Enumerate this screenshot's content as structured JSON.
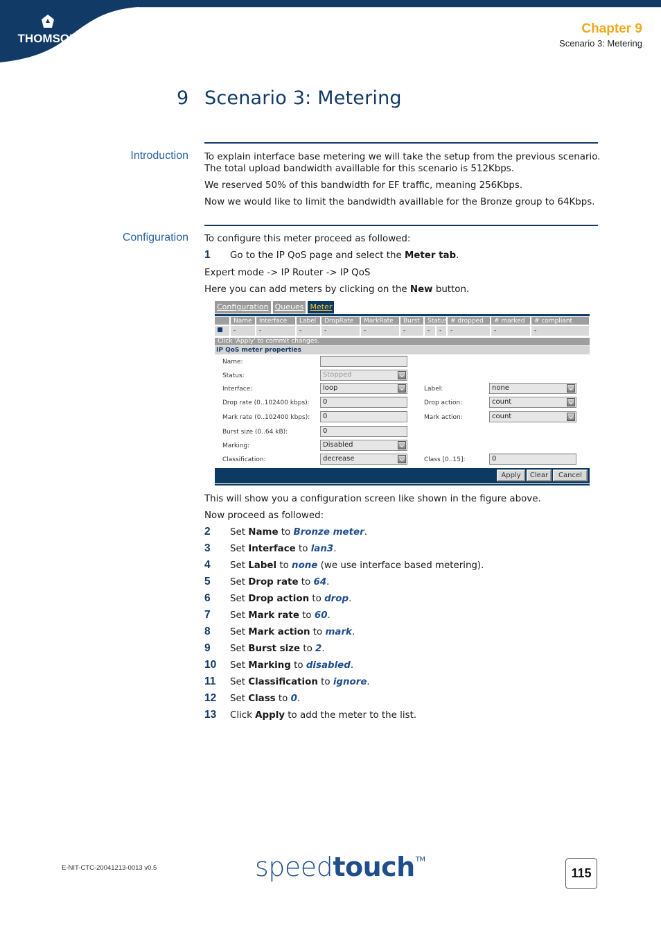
{
  "header": {
    "brand_logo": "THOMSON",
    "chapter": "Chapter 9",
    "chapter_subtitle": "Scenario 3: Metering",
    "colors": {
      "navy": "#123a66",
      "chapter_orange": "#f3a81b"
    }
  },
  "title": {
    "number": "9",
    "text": "Scenario 3: Metering"
  },
  "introduction": {
    "heading": "Introduction",
    "paragraphs": [
      "To explain interface base metering we will take the setup from the previous scenario.",
      "The total upload bandwidth availlable for this scenario is 512Kbps.",
      "We reserved 50% of this bandwidth for EF traffic, meaning 256Kbps.",
      "Now we would like to limit the bandwidth availlable for the Bronze group to 64Kbps."
    ]
  },
  "configuration": {
    "heading": "Configuration",
    "lead": "To configure this meter proceed as followed:",
    "step1": {
      "num": "1",
      "pre": "Go to the IP QoS page and select the ",
      "bold": "Meter tab",
      "post": "."
    },
    "path": "Expert mode -> IP Router -> IP QoS",
    "new_pre": "Here you can add meters by clicking on the ",
    "new_bold": "New",
    "new_post": " button.",
    "after_figure": "This will show you a configuration screen like shown in the figure above.",
    "proceed": "Now proceed as followed:",
    "steps": [
      {
        "num": "2",
        "verb": "Set ",
        "field": "Name",
        "to": " to ",
        "value": "Bronze meter",
        "rest": "."
      },
      {
        "num": "3",
        "verb": "Set ",
        "field": "Interface",
        "to": " to ",
        "value": "lan3",
        "rest": "."
      },
      {
        "num": "4",
        "verb": "Set ",
        "field": "Label",
        "to": " to ",
        "value": "none",
        "rest": " (we use interface based metering)."
      },
      {
        "num": "5",
        "verb": "Set ",
        "field": "Drop rate",
        "to": " to ",
        "value": "64",
        "rest": "."
      },
      {
        "num": "6",
        "verb": "Set ",
        "field": "Drop action",
        "to": " to ",
        "value": "drop",
        "rest": "."
      },
      {
        "num": "7",
        "verb": "Set ",
        "field": "Mark rate",
        "to": " to ",
        "value": "60",
        "rest": "."
      },
      {
        "num": "8",
        "verb": "Set ",
        "field": "Mark action",
        "to": " to ",
        "value": "mark",
        "rest": "."
      },
      {
        "num": "9",
        "verb": "Set ",
        "field": "Burst size",
        "to": " to ",
        "value": "2",
        "rest": "."
      },
      {
        "num": "10",
        "verb": "Set ",
        "field": "Marking",
        "to": " to ",
        "value": "disabled",
        "rest": "."
      },
      {
        "num": "11",
        "verb": "Set ",
        "field": "Classification",
        "to": " to ",
        "value": "ignore",
        "rest": "."
      },
      {
        "num": "12",
        "verb": "Set ",
        "field": "Class",
        "to": " to ",
        "value": "0",
        "rest": "."
      },
      {
        "num": "13",
        "verb": "Click ",
        "field": "Apply",
        "to": "",
        "value": "",
        "rest": " to add the meter to the list."
      }
    ]
  },
  "screenshot": {
    "tabs": [
      {
        "label": "Configuration",
        "active": false
      },
      {
        "label": "Queues",
        "active": false
      },
      {
        "label": "Meter",
        "active": true
      }
    ],
    "table": {
      "columns": [
        "",
        "Name",
        "Interface",
        "Label",
        "DropRate",
        "MarkRate",
        "Burst",
        "Status",
        "",
        "# dropped",
        "# marked",
        "# compliant"
      ],
      "row": [
        "",
        "-",
        "-",
        "-",
        "-",
        "-",
        "-",
        "-",
        "-",
        "-",
        "-",
        "-"
      ]
    },
    "commit_message": "Click 'Apply' to commit changes.",
    "properties_heading": "IP QoS meter properties",
    "fields": {
      "name": {
        "label": "Name:",
        "value": ""
      },
      "status": {
        "label": "Status:",
        "value": "Stopped"
      },
      "interface": {
        "label": "Interface:",
        "value": "loop"
      },
      "drop_rate": {
        "label": "Drop rate (0..102400 kbps):",
        "value": "0"
      },
      "mark_rate": {
        "label": "Mark rate (0..102400 kbps):",
        "value": "0"
      },
      "burst_size": {
        "label": "Burst size (0..64 kB):",
        "value": "0"
      },
      "marking": {
        "label": "Marking:",
        "value": "Disabled"
      },
      "classification": {
        "label": "Classification:",
        "value": "decrease"
      },
      "label": {
        "label": "Label:",
        "value": "none"
      },
      "drop_action": {
        "label": "Drop action:",
        "value": "count"
      },
      "mark_action": {
        "label": "Mark action:",
        "value": "count"
      },
      "class": {
        "label": "Class [0..15]:",
        "value": "0"
      }
    },
    "buttons": {
      "apply": "Apply",
      "clear": "Clear",
      "cancel": "Cancel"
    }
  },
  "footer": {
    "doc_id": "E-NIT-CTC-20041213-0013 v0.5",
    "brand_light": "speed",
    "brand_bold": "touch",
    "brand_tm": "TM",
    "page_number": "115"
  }
}
